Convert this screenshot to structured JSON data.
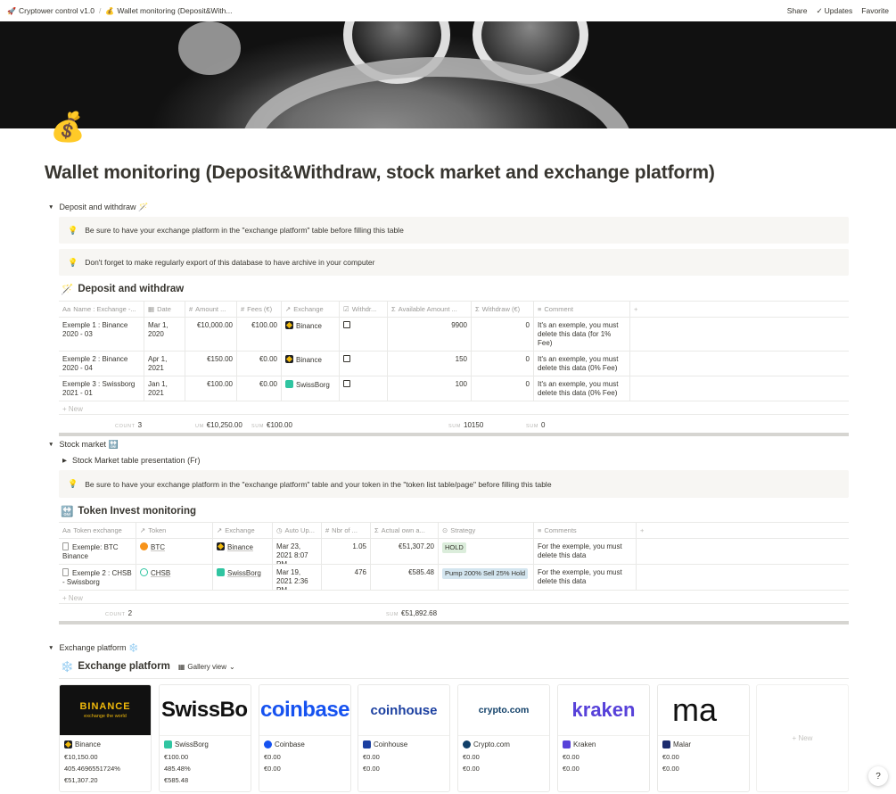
{
  "breadcrumb": {
    "workspace": "Cryptower control v1.0",
    "workspace_icon": "🚀",
    "page": "Wallet monitoring (Deposit&With...",
    "page_icon": "💰"
  },
  "topbar": {
    "share": "Share",
    "updates": "Updates",
    "favorite": "Favorite"
  },
  "page": {
    "icon": "💰",
    "title": "Wallet monitoring (Deposit&Withdraw, stock market and exchange platform)"
  },
  "deposit_section": {
    "toggle_label": "Deposit and withdraw 🪄",
    "callout_1": "Be sure to have your exchange platform in the \"exchange platform\" table before filling this table",
    "callout_2": "Don't forget to make regularly export of this database to have archive in your computer",
    "db_icon": "🪄",
    "db_title": "Deposit and withdraw",
    "columns": [
      {
        "icon": "Aa",
        "label": "Name : Exchange -..."
      },
      {
        "icon": "▦",
        "label": "Date"
      },
      {
        "icon": "#",
        "label": "Amount ..."
      },
      {
        "icon": "#",
        "label": "Fees (€)"
      },
      {
        "icon": "↗",
        "label": "Exchange"
      },
      {
        "icon": "☑",
        "label": "Withdr..."
      },
      {
        "icon": "Σ",
        "label": "Available Amount ..."
      },
      {
        "icon": "Σ",
        "label": "Withdraw (€)"
      },
      {
        "icon": "≡",
        "label": "Comment"
      }
    ],
    "rows": [
      {
        "name": "Exemple 1 : Binance 2020 - 03",
        "date": "Mar 1, 2020",
        "amount": "€10,000.00",
        "fees": "€100.00",
        "exchange": "Binance",
        "exchange_logo": "binance",
        "available": "9900",
        "withdraw": "0",
        "comment": "It's an exemple, you must delete this data (for 1% Fee)"
      },
      {
        "name": "Exemple 2 : Binance 2020 - 04",
        "date": "Apr 1, 2021",
        "amount": "€150.00",
        "fees": "€0.00",
        "exchange": "Binance",
        "exchange_logo": "binance",
        "available": "150",
        "withdraw": "0",
        "comment": "It's an exemple, you must delete this data (0% Fee)"
      },
      {
        "name": "Exemple 3 : Swissborg 2021 - 01",
        "date": "Jan 1, 2021",
        "amount": "€100.00",
        "fees": "€0.00",
        "exchange": "SwissBorg",
        "exchange_logo": "swiss",
        "available": "100",
        "withdraw": "0",
        "comment": "It's an exemple, you must delete this data (0% Fee)"
      }
    ],
    "new_label": "+ New",
    "calc": {
      "count_label": "COUNT",
      "count": "3",
      "sum_label_1": "UM",
      "sum_amount": "€10,250.00",
      "sum_label_2": "SUM",
      "sum_fees": "€100.00",
      "sum_label_3": "SUM",
      "sum_available": "10150",
      "sum_label_4": "SUM",
      "sum_withdraw": "0"
    }
  },
  "stock_section": {
    "toggle_label": "Stock market 🔛",
    "sub_toggle": "Stock Market table presentation (Fr)",
    "callout": "Be sure to have your exchange platform in the \"exchange platform\" table and your token in the \"token list table/page\" before filling this table",
    "db_icon": "🔛",
    "db_title": "Token Invest monitoring",
    "columns": [
      {
        "icon": "Aa",
        "label": "Token exchange"
      },
      {
        "icon": "↗",
        "label": "Token"
      },
      {
        "icon": "↗",
        "label": "Exchange"
      },
      {
        "icon": "◷",
        "label": "Auto Up..."
      },
      {
        "icon": "#",
        "label": "Nbr of ..."
      },
      {
        "icon": "Σ",
        "label": "Actual own a..."
      },
      {
        "icon": "⊙",
        "label": "Strategy"
      },
      {
        "icon": "≡",
        "label": "Comments"
      }
    ],
    "rows": [
      {
        "name": "Exemple: BTC Binance",
        "token": "BTC",
        "token_logo": "btc",
        "exchange": "Binance",
        "exchange_logo": "binance",
        "updated": "Mar 23, 2021 8:07 PM",
        "nbr": "1.05",
        "own": "€51,307.20",
        "strategy": "HOLD",
        "strategy_style": "hold",
        "comment": "For the exemple, you must delete this data"
      },
      {
        "name": "Exemple 2 : CHSB - Swissborg",
        "token": "CHSB",
        "token_logo": "chsb",
        "exchange": "SwissBorg",
        "exchange_logo": "swiss",
        "updated": "Mar 19, 2021 2:36 PM",
        "nbr": "476",
        "own": "€585.48",
        "strategy": "Pump 200% Sell 25% Hold",
        "strategy_style": "pump",
        "comment": "For the exemple, you must delete this data"
      }
    ],
    "new_label": "+ New",
    "calc": {
      "count_label": "COUNT",
      "count": "2",
      "sum_label": "SUM",
      "sum_own": "€51,892.68"
    }
  },
  "exchange_section": {
    "toggle_label": "Exchange platform ❄️",
    "db_icon": "❄️",
    "db_title": "Exchange platform",
    "view_label": "Gallery view",
    "cards": [
      {
        "name": "Binance",
        "logo": "binance",
        "v1": "€10,150.00",
        "v2": "405.4696551724%",
        "v3": "€51,307.20"
      },
      {
        "name": "SwissBorg",
        "logo": "swiss",
        "v1": "€100.00",
        "v2": "485.48%",
        "v3": "€585.48"
      },
      {
        "name": "Coinbase",
        "logo": "coin",
        "v1": "€0.00",
        "v2": "€0.00",
        "v3": ""
      },
      {
        "name": "Coinhouse",
        "logo": "coinhouse",
        "v1": "€0.00",
        "v2": "€0.00",
        "v3": ""
      },
      {
        "name": "Crypto.com",
        "logo": "crypto",
        "v1": "€0.00",
        "v2": "€0.00",
        "v3": ""
      },
      {
        "name": "Kraken",
        "logo": "kraken",
        "v1": "€0.00",
        "v2": "€0.00",
        "v3": ""
      },
      {
        "name": "Malar",
        "logo": "malar",
        "v1": "€0.00",
        "v2": "€0.00",
        "v3": ""
      }
    ],
    "cover_texts": {
      "binance_brand": "BINANCE",
      "binance_tag": "exchange the world",
      "swiss": "SwissBo",
      "coinbase": "coinbase",
      "coinhouse": "coinhouse",
      "crypto": "crypto.com",
      "kraken": "kraken",
      "malar": "ma"
    },
    "new_card": "+ New"
  },
  "help": "?",
  "colors": {
    "text": "#37352f",
    "muted": "#9b9a97",
    "border": "#e9e9e7",
    "callout_bg": "#f7f6f3",
    "binance_gold": "#f0b90b",
    "coinbase_blue": "#1652f0",
    "kraken_purple": "#5741d9"
  }
}
